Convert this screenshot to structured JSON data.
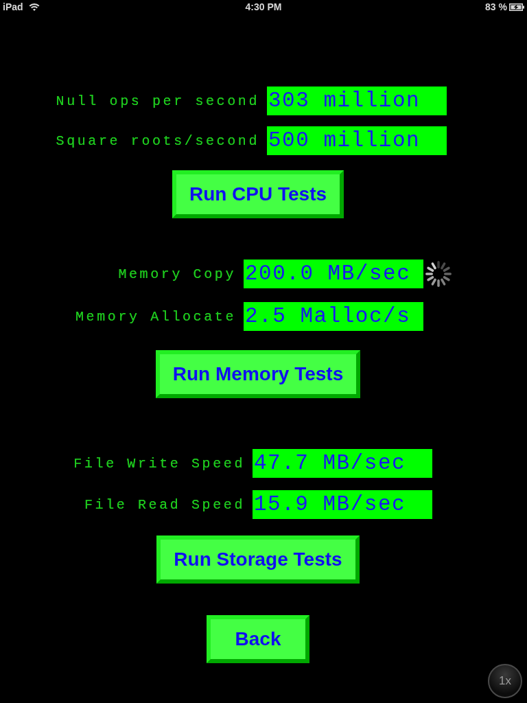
{
  "status_bar": {
    "carrier": "iPad",
    "time": "4:30 PM",
    "battery": "83 %"
  },
  "sections": [
    {
      "rows": [
        {
          "label": "Null ops per second",
          "value": "303 million",
          "busy": false
        },
        {
          "label": "Square roots/second",
          "value": "500 million",
          "busy": false
        }
      ],
      "button": "Run CPU Tests"
    },
    {
      "rows": [
        {
          "label": "Memory Copy",
          "value": "200.0 MB/sec",
          "busy": true
        },
        {
          "label": "Memory Allocate",
          "value": "2.5 Malloc/s",
          "busy": false
        }
      ],
      "button": "Run Memory Tests"
    },
    {
      "rows": [
        {
          "label": "File Write Speed",
          "value": "47.7 MB/sec",
          "busy": false
        },
        {
          "label": "File Read Speed",
          "value": "15.9 MB/sec",
          "busy": false
        }
      ],
      "button": "Run Storage Tests"
    }
  ],
  "back_button": "Back",
  "zoom_button": "1x"
}
